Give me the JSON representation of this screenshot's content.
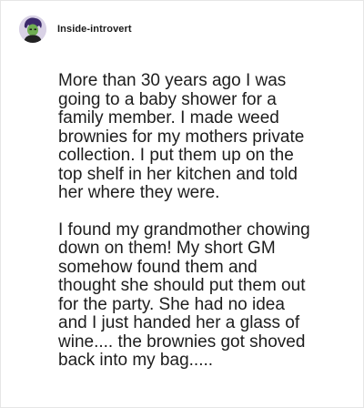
{
  "post": {
    "author": "Inside-introvert",
    "paragraphs": [
      "More than 30 years ago I was\ngoing to a baby shower for a\nfamily member. I made weed\nbrownies for my mothers private\ncollection. I put them up on the\ntop shelf in her kitchen and told\nher where they were.",
      "I found my grandmother chowing\ndown on them! My short GM\nsomehow found them and\nthought she should put them out\nfor the party. She had no idea\nand I just handed her a glass of\nwine.... the brownies got shoved\nback into my bag....."
    ]
  },
  "avatar": {
    "icon": "user-avatar-icon",
    "colors": {
      "background": "#d9d2e6",
      "hair": "#3b2a6b",
      "face": "#6fae52",
      "shirt": "#222222"
    }
  }
}
